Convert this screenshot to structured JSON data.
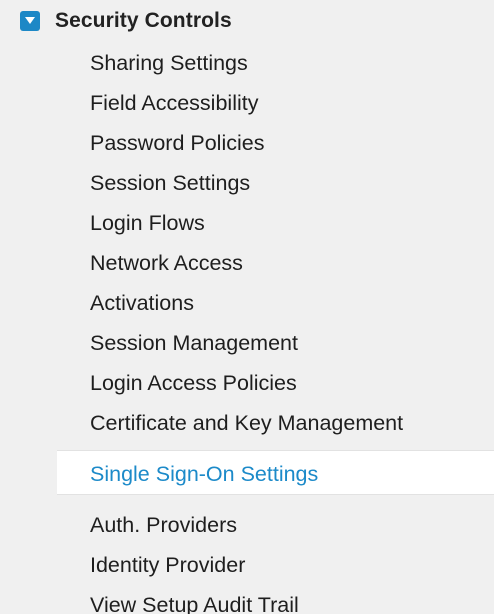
{
  "section": {
    "title": "Security Controls",
    "toggle_icon": "caret-down-icon",
    "accent_color": "#1d88c6"
  },
  "items": [
    {
      "label": "Sharing Settings"
    },
    {
      "label": "Field Accessibility"
    },
    {
      "label": "Password Policies"
    },
    {
      "label": "Session Settings"
    },
    {
      "label": "Login Flows"
    },
    {
      "label": "Network Access"
    },
    {
      "label": "Activations"
    },
    {
      "label": "Session Management"
    },
    {
      "label": "Login Access Policies"
    },
    {
      "label": "Certificate and Key Management"
    },
    {
      "label": "Single Sign-On Settings",
      "selected": true
    },
    {
      "label": "Auth. Providers"
    },
    {
      "label": "Identity Provider"
    },
    {
      "label": "View Setup Audit Trail"
    }
  ],
  "colors": {
    "selected_text": "#1c8ac9",
    "background": "#f0f0f0"
  }
}
